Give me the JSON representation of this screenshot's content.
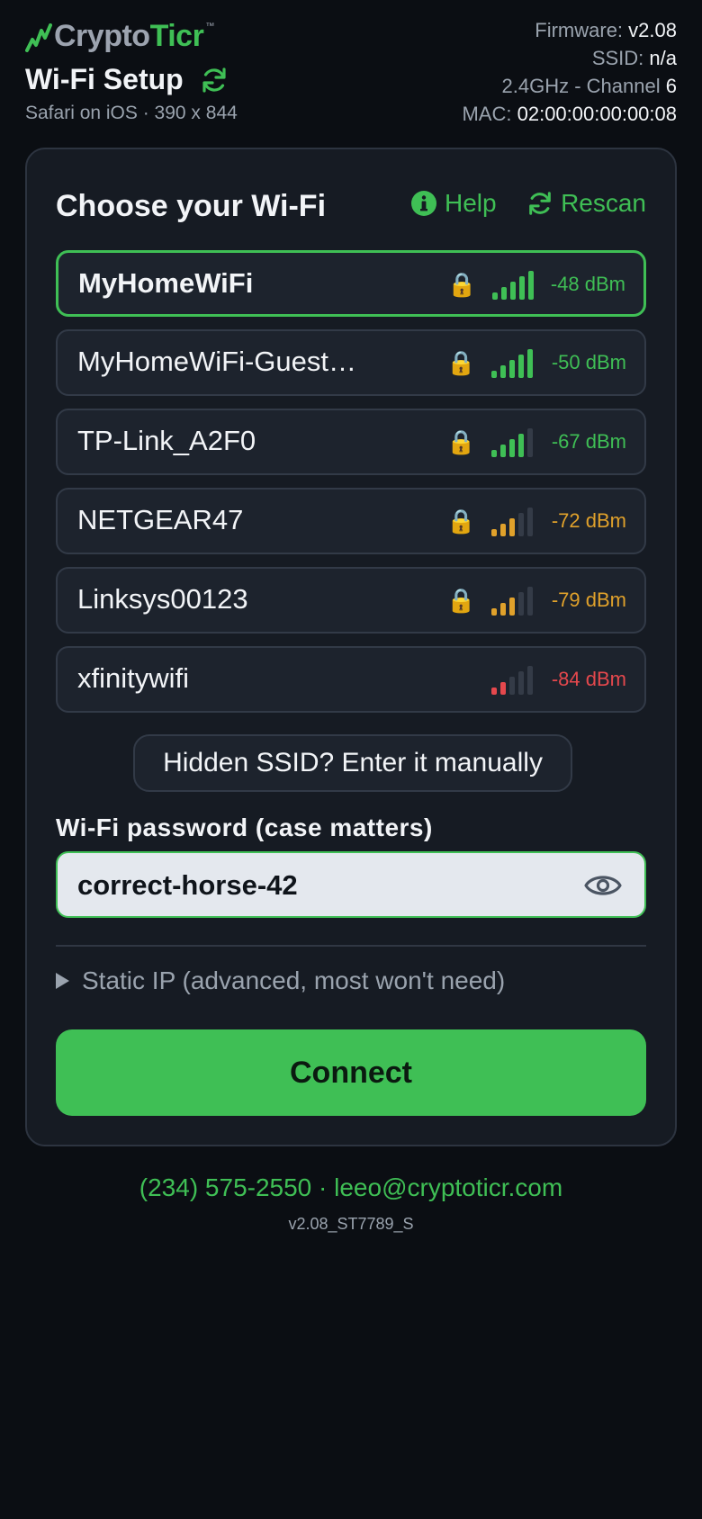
{
  "brand": {
    "logo_part1": "Crypto",
    "logo_part2": "Ticr",
    "tm": "™"
  },
  "header": {
    "title": "Wi-Fi Setup",
    "subtitle": "Safari on iOS · 390 x 844",
    "device_info": {
      "firmware_label": "Firmware:",
      "firmware_value": "v2.08",
      "ssid_label": "SSID:",
      "ssid_value": "n/a",
      "band_label": "2.4GHz - Channel",
      "channel_value": "6",
      "mac_label": "MAC:",
      "mac_value": "02:00:00:00:00:08"
    }
  },
  "card": {
    "title": "Choose your Wi-Fi",
    "help_label": "Help",
    "rescan_label": "Rescan",
    "networks": [
      {
        "name": "MyHomeWiFi",
        "locked": true,
        "signal_bars": 5,
        "dbm": "-48 dBm",
        "color": "#3fbf55",
        "selected": true
      },
      {
        "name": "MyHomeWiFi-Guest…",
        "locked": true,
        "signal_bars": 5,
        "dbm": "-50 dBm",
        "color": "#3fbf55",
        "selected": false
      },
      {
        "name": "TP-Link_A2F0",
        "locked": true,
        "signal_bars": 4,
        "dbm": "-67 dBm",
        "color": "#3fbf55",
        "selected": false
      },
      {
        "name": "NETGEAR47",
        "locked": true,
        "signal_bars": 3,
        "dbm": "-72 dBm",
        "color": "#e0a12b",
        "selected": false
      },
      {
        "name": "Linksys00123",
        "locked": true,
        "signal_bars": 3,
        "dbm": "-79 dBm",
        "color": "#e0a12b",
        "selected": false
      },
      {
        "name": "xfinitywifi",
        "locked": false,
        "signal_bars": 2,
        "dbm": "-84 dBm",
        "color": "#e5484d",
        "selected": false
      }
    ],
    "manual_button": "Hidden SSID? Enter it manually",
    "password_label": "Wi-Fi password (case matters)",
    "password_value": "correct-horse-42",
    "static_ip_label": "Static IP (advanced, most won't need)",
    "connect_label": "Connect"
  },
  "footer": {
    "contact": "(234) 575-2550 · leeo@cryptoticr.com",
    "version": "v2.08_ST7789_S"
  },
  "colors": {
    "accent": "#3fbf55",
    "warn": "#e0a12b",
    "bad": "#e5484d",
    "card_bg": "#161b23",
    "page_bg": "#0b0e13"
  }
}
